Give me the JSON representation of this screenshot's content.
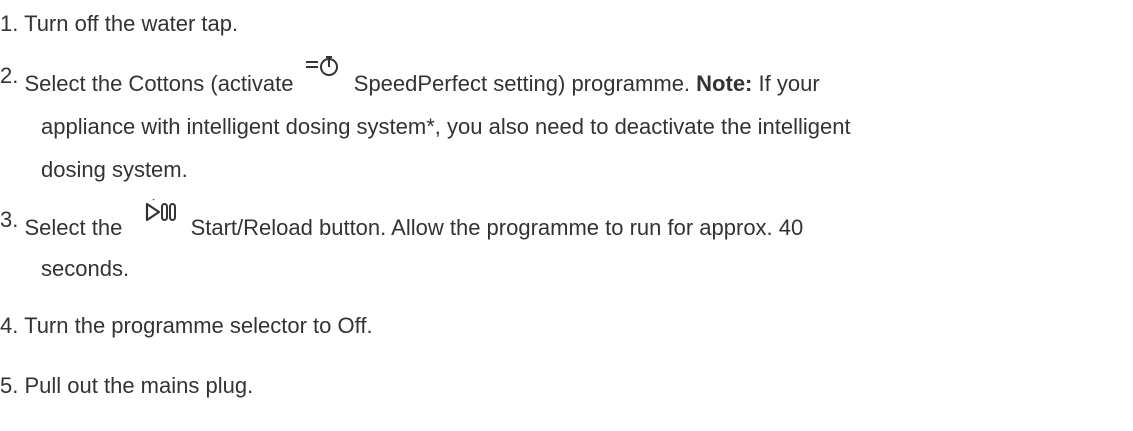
{
  "steps": [
    {
      "number": "1.",
      "text": "Turn off the water tap."
    },
    {
      "number": "2.",
      "line1_pre": "Select the Cottons (activate",
      "icon": "speedperfect-icon",
      "line1_post": "SpeedPerfect setting) programme.",
      "note_label": "Note:",
      "line1_tail": "If your",
      "line2": "appliance with intelligent dosing system*, you also need to deactivate the intelligent",
      "line3": "dosing system."
    },
    {
      "number": "3.",
      "line1_pre": "Select the",
      "icon": "start-reload-icon",
      "line1_post": "Start/Reload button. Allow the programme to run for approx. 40",
      "line2": "seconds."
    },
    {
      "number": "4.",
      "text": "Turn the programme selector to Off."
    },
    {
      "number": "5.",
      "text": "Pull out the mains plug."
    }
  ]
}
